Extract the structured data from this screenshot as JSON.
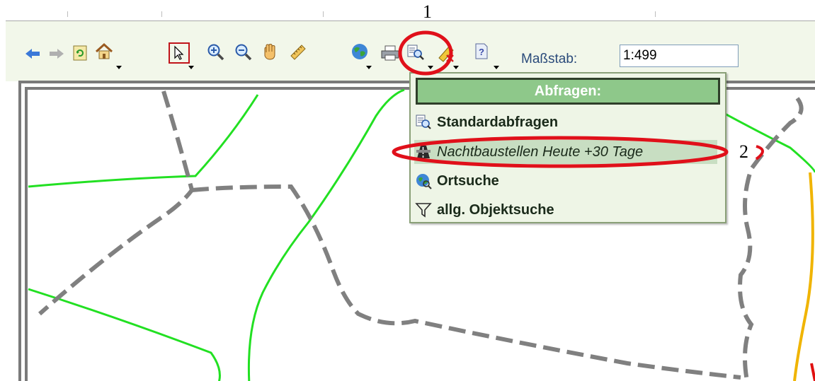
{
  "annotations": {
    "callout_1": "1",
    "callout_2": "2"
  },
  "toolbar": {
    "buttons": [
      {
        "name": "back-arrow-icon"
      },
      {
        "name": "forward-arrow-icon"
      },
      {
        "name": "refresh-icon"
      },
      {
        "name": "home-icon"
      },
      {
        "name": "select-pointer-icon"
      },
      {
        "name": "zoom-in-icon"
      },
      {
        "name": "zoom-out-icon"
      },
      {
        "name": "pan-hand-icon"
      },
      {
        "name": "measure-ruler-icon"
      },
      {
        "name": "globe-icon"
      },
      {
        "name": "print-icon"
      },
      {
        "name": "query-icon"
      },
      {
        "name": "eraser-clear-icon"
      },
      {
        "name": "help-icon"
      }
    ],
    "scale_label": "Maßstab:",
    "scale_value": "1:499"
  },
  "popup": {
    "title": "Abfragen:",
    "items": [
      {
        "label": "Standardabfragen",
        "icon": "query-icon"
      },
      {
        "label": "Nachtbaustellen Heute +30 Tage",
        "icon": "road-construction-icon",
        "selected": true
      },
      {
        "label": "Ortsuche",
        "icon": "globe-search-icon"
      },
      {
        "label": "allg. Objektsuche",
        "icon": "filter-funnel-icon"
      }
    ]
  },
  "colors": {
    "toolbar_bg": "#f2f7ea",
    "popup_header": "#8ec88a",
    "annotation_red": "#e0101a",
    "road_green": "#22e022",
    "road_gray": "#808080",
    "road_yellow": "#f0b400"
  }
}
